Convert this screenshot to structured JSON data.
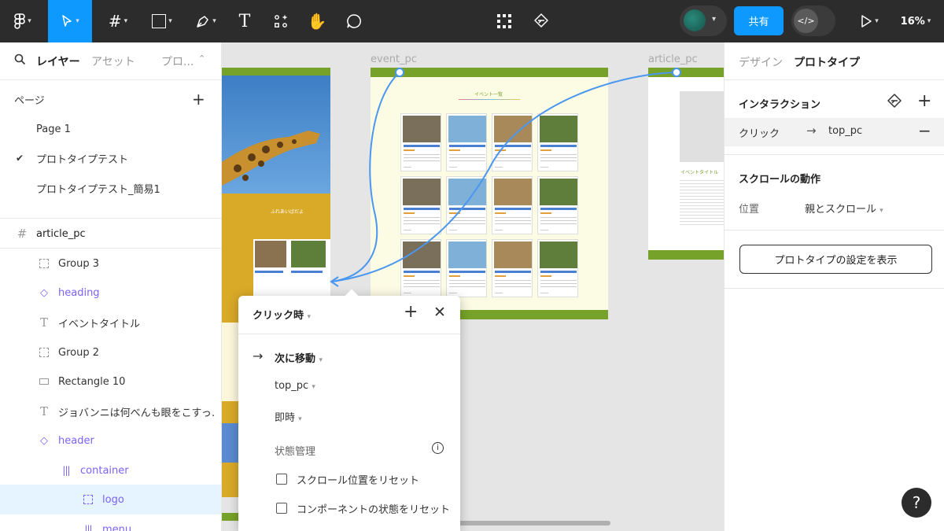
{
  "toolbar": {
    "zoom": "16%",
    "share_label": "共有"
  },
  "left_panel": {
    "tabs": {
      "layers": "レイヤー",
      "assets": "アセット",
      "proto": "プロ..."
    },
    "pages_title": "ページ",
    "pages": [
      "Page 1",
      "プロトタイプテスト",
      "プロトタイプテスト_簡易1"
    ],
    "frame_name": "article_pc",
    "layers": [
      "Group 3",
      "heading",
      "イベントタイトル",
      "Group 2",
      "Rectangle 10",
      "ジョバンニは何べんも眼をこすっ…",
      "header",
      "container",
      "logo",
      "menu"
    ]
  },
  "right_panel": {
    "tabs": {
      "design": "デザイン",
      "prototype": "プロトタイプ"
    },
    "interaction_title": "インタラクション",
    "trigger": "クリック",
    "target": "top_pc",
    "scroll_title": "スクロールの動作",
    "position_label": "位置",
    "position_value": "親とスクロール",
    "settings_button": "プロトタイプの設定を表示"
  },
  "canvas": {
    "frames": {
      "event": "event_pc",
      "article": "article_pc"
    },
    "event_heading": "イベント一覧",
    "article_heading": "イベントタイトル",
    "left_caption": "ふれあいばだよ",
    "card_titles": [
      "猫パークへGO！",
      "キリンに会って散歩",
      "ライオンとの昼寝",
      "アライグマの親子会"
    ]
  },
  "popup": {
    "trigger": "クリック時",
    "action": "次に移動",
    "destination": "top_pc",
    "animation": "即時",
    "state_title": "状態管理",
    "reset_scroll": "スクロール位置をリセット",
    "reset_component": "コンポーネントの状態をリセット"
  },
  "colors": {
    "accent": "#0d99ff",
    "toolbar_bg": "#2c2c2c",
    "layer_purple": "#7b61ff",
    "connector": "#4a97f0",
    "site_green": "#77a22a",
    "event_bg": "#fcfbe3"
  }
}
